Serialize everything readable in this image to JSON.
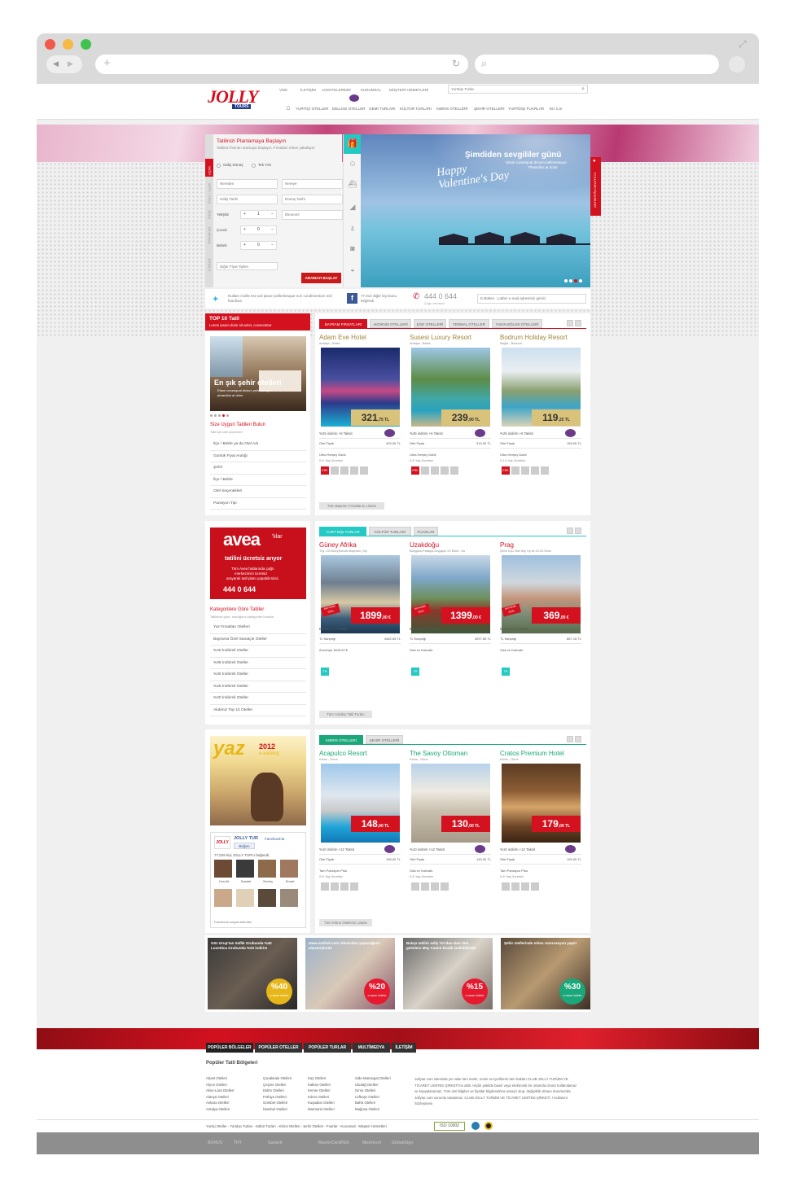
{
  "browser": {
    "nav_back": "◀",
    "nav_fwd": "▶",
    "new_tab": "+",
    "reload": "↻",
    "search": "⌕"
  },
  "header": {
    "logo_main": "JOLLY",
    "logo_sub": "TOURS",
    "top_links": [
      "VİZE",
      "İLETİŞİM",
      "ACENTELERİMİZ",
      "KURUMSAL",
      "MÜŞTERİ HİZMETLERİ"
    ],
    "search_select": "Yurtdışı Turlar",
    "search_icon": "⌕",
    "nav": [
      "YURTİÇİ OTELLER",
      "DELUXE OTELLER",
      "GEMİ TURLARI",
      "KÜLTÜR TURLARI",
      "KIBRIS OTELLERİ",
      "ŞEHİR OTELLERİ",
      "YURTDIŞI FUARLAR",
      "M.I.C.E"
    ]
  },
  "search": {
    "title": "Tatilinizi Planlamaya Başlayın",
    "subtitle": "Tatilinizi hemen aramaya başlayın. Fırsatları erken yakalayın",
    "side_tabs": [
      "UÇAK",
      "OTEL + UÇAK",
      "ARAÇ",
      "TRANSFER",
      "TURLAR"
    ],
    "radio1": "Gidiş Dönüş",
    "radio2": "Tek Yön",
    "from": "Nereden",
    "to": "Nereye",
    "depart": "Gidiş Tarihi",
    "return": "Dönüş Tarihi",
    "adult": "Yetişkin",
    "adult_val": "1",
    "child": "Çocuk",
    "child_val": "0",
    "baby": "Bebek",
    "baby_val": "0",
    "cls": "Ekonomi",
    "other": "Diğer Fiyat Tipleri",
    "button": "ARAMAYI BAŞLAT"
  },
  "banner": {
    "title": "Şimdiden sevgililer günü",
    "line1": "Etiam consequat dictum pellentesque",
    "line2": "Phasellus at dolor",
    "script": "Happy Valentine's Day",
    "side_label": "KULLANICI İŞLEMLERİ"
  },
  "social": {
    "tweet": "Nullam mollis est sed ipsum pellentesque non condimentum nisl faucibus.",
    "fb": "77.012 diğer kişi bunu beğendi.",
    "phone": "444 0 644",
    "phone_sub": "Çağrı merkezi",
    "ebulten": "E-Bülten : Lütfen e-mail adresinizi giriniz"
  },
  "top10": {
    "title": "TOP 10 Tatil",
    "sub": "Lorem ipsum dolor sit amet, consectetur",
    "photo_title": "En şık şehir otelleri",
    "photo_sub1": "Etiam consequat dictum pellentesque",
    "photo_sub2": "phasellus at dolor",
    "find_title": "Size Uygun Tatilleri Bulun",
    "find_sub": "Tatil için tatil çözümleri",
    "items": [
      "İlçe / Belde ya da Otel Adı",
      "Günlük Fiyat Aralığı",
      "Şehir",
      "İlçe / Belde",
      "Otel Seçenekleri",
      "Pansiyon Tipi"
    ]
  },
  "sec1": {
    "tabs": [
      "BAYRAM FIRSATLARI",
      "AKDENİZ OTELLERİ",
      "EGE OTELLERİ",
      "TERMAL OTELLER",
      "YAKIN BÖLGE OTELLERİ"
    ],
    "list_btn": "Tüm Bayram Fırsatlarını Listele",
    "cards": [
      {
        "name": "Adam Eve Hotel",
        "loc": "Antalya - Belek",
        "price_big": "321",
        "price_small": ",75 TL",
        "promo": "%25 indirim +6 Taksit",
        "row1": "Otel Fiyatı",
        "row1v": "429.00 TL",
        "row2": "Ultra Herşey Dahil",
        "row3": "0-6 Yaş Ücretsiz"
      },
      {
        "name": "Susesi Luxury Resort",
        "loc": "Antalya - Belek",
        "price_big": "239",
        "price_small": ",90 TL",
        "promo": "%25 indirim +6 Taksit",
        "row1": "Otel Fiyatı",
        "row1v": "319.00 TL",
        "row2": "Ultra Herşey Dahil",
        "row3": "0-6 Yaş Ücretsiz"
      },
      {
        "name": "Bodrum Holiday Resort",
        "loc": "Muğla - Bodrum",
        "price_big": "119",
        "price_small": ",25 TL",
        "promo": "%25 indirim +6 Taksit",
        "row1": "Otel Fiyatı",
        "row1v": "159.00 TL",
        "row2": "Ultra Herşey Dahil",
        "row3": "0-14 Yaş Ücretsiz"
      }
    ],
    "erk": "ERK"
  },
  "avea": {
    "brand": "avea",
    "brand2": "'lılar",
    "l1": "tatilini ücretsiz arıyor",
    "l2": "Tüm Avea hatlarında çağrı",
    "l3": "merkezimizi ücretsiz",
    "l4": "arayarak tatil planı yapabilirsiniz.",
    "phone": "444 0 644"
  },
  "cats": {
    "title": "Kategorilere Göre Tatiller",
    "sub": "Tatilinize göre, aradığınız kategoriler burada",
    "items": [
      "Yaz Fırsatları Otelleri",
      "Bayrama Özel Sanatçılı Oteller",
      "%40 İndirimli Oteller",
      "%35 İndirimli Oteller",
      "%30 İndirimli Oteller",
      "%25 İndirimli Oteller",
      "%20 İndirimli Oteller",
      "Akdeniz Top 10 Oteller"
    ]
  },
  "sec2": {
    "tabs": [
      "YURT DIŞI TURLAR",
      "KÜLTÜR TURLARI",
      "FUARLAR"
    ],
    "list_btn": "Tüm Yurtdışı Tatil Turları",
    "badge": "BAYRAMA ÖZEL",
    "tr": "TR",
    "cards": [
      {
        "name": "Güney Afrika",
        "loc": "Thy -20 Ekim(Kurban Bayramı ) By",
        "price_big": "1899",
        "price_small": ",00 €",
        "promo": "Bonus 2-12 Taksit",
        "row1": "TL Karşılığı",
        "row1v": "4462.65 TL",
        "row2": "Avea'lıya 1849.00 €"
      },
      {
        "name": "Uzakdoğu",
        "loc": "Bangkok-Pattaya-Singapur 29 Ekim - Ku",
        "price_big": "1399",
        "price_small": ",00 €",
        "promo": "Bonus 2-12 Taksit",
        "row1": "TL Karşılığı",
        "row1v": "3297.65 TL",
        "row2": "Oda ve Kahvaltı"
      },
      {
        "name": "Prag",
        "loc": "Şehir Dışı Otel Sky Hy ile 22-25 Ekim",
        "price_big": "369",
        "price_small": ",00 €",
        "promo": "Bonus 2-12 Taksit",
        "row1": "TL Karşılığı",
        "row1v": "867.15 TL",
        "row2": "Oda ve Kahvaltı"
      }
    ]
  },
  "yaz": {
    "big": "yaz",
    "year": "2012",
    "sub": "e-katalog"
  },
  "fbbox": {
    "name": "JOLLY TUR",
    "suffix": "Facebook'ta",
    "like": "Beğen",
    "count": "77,029 kişi JOLLY TUR'u beğendi.",
    "people": [
      "Can Ali",
      "Saadet",
      "Sevinç",
      "Smart"
    ],
    "footer": "Facebook sosyal eklentisi"
  },
  "sec3": {
    "tabs": [
      "KIBRIS OTELLERİ",
      "ŞEHİR OTELLERİ"
    ],
    "list_btn": "Tüm Kıbrıs Otellerini Listele",
    "cards": [
      {
        "name": "Acapulco Resort",
        "loc": "Kıbrıs - Girne",
        "price_big": "148",
        "price_small": ",00 TL",
        "promo": "%10 indirim +12 Taksit",
        "row1": "Otel Fiyatı",
        "row1v": "165.00 TL",
        "row2": "Tam Pansiyon Plus",
        "row3": "0-6 Yaş Ücretsiz"
      },
      {
        "name": "The Savoy Ottoman",
        "loc": "Kıbrıs - Girne",
        "price_big": "130",
        "price_small": ",00 TL",
        "promo": "%10 indirim +12 Taksit",
        "row1": "Otel Fiyatı",
        "row1v": "145.00 TL",
        "row2": "Oda ve Kahvaltı",
        "row3": "0-6 Yaş Ücretsiz"
      },
      {
        "name": "Cratos Premium Hotel",
        "loc": "Kıbrıs - Girne",
        "price_big": "179",
        "price_small": ",00 TL",
        "promo": "%10 indirim +12 Taksit",
        "row1": "Otel Fiyatı",
        "row1v": "199.00 TL",
        "row2": "Tam Pansiyon Plus",
        "row3": "0-6 Yaş Ücretsiz"
      }
    ]
  },
  "promos": [
    {
      "text": "Göz Grup'tan Saflık Grubunda %40 Luxottica Grubunda %20 indirim",
      "pct": "%40",
      "lbl": "a varan indirim"
    },
    {
      "text": "www.vatilick.com sitesinden yapacağınız alışverişlerde",
      "pct": "%20",
      "lbl": "a varan indirim"
    },
    {
      "text": "Balayı tatilini Jolly Tur'dan alan tüm gelinlere Mey Casini kiralık Gelinliklerde",
      "pct": "%15",
      "lbl": "a varan indirim"
    },
    {
      "text": "Şehir otellerinde erken rezervasyon yapın",
      "pct": "%30",
      "lbl": "a varan indirim"
    }
  ],
  "footer": {
    "tabs": [
      "POPÜLER BÖLGELER",
      "POPÜLER OTELLER",
      "POPÜLER TURLAR",
      "MULTİMEDYA",
      "İLETİŞİM"
    ],
    "title": "Popüler Tatil Bölgeleri",
    "col1": [
      "Abant Otelleri",
      "Afyon Otelleri",
      "Akso-Lara Otelleri",
      "Alanya Otelleri",
      "Ankara Otelleri",
      "Antalya Otelleri"
    ],
    "col2": [
      "Çanakkale Otelleri",
      "Çeşme Otelleri",
      "Didim Otelleri",
      "Fethiye Otelleri",
      "Gümbet Otelleri",
      "İstanbul Otelleri"
    ],
    "col3": [
      "Kaş Otelleri",
      "Kalkan Otelleri",
      "Kemer Otelleri",
      "Kıbrıs Otelleri",
      "Kuşadası Otelleri",
      "Marmaris Otelleri"
    ],
    "col4": [
      "Side-Manavgat Otelleri",
      "Uludağ Otelleri",
      "Girne Otelleri",
      "Lefkoşe Otelleri",
      "Bafra Otelleri",
      "Mağosa Otelleri"
    ],
    "legal": "Jollytur.com sitesinde yer alan tüm metin, resim ve içeriklerin tüm hakları CLUB JOLLY TURİZM VE TİCARET LİMİTED ŞİRKETİ'ne aittir. Hiçbir şekilde basılı veya elektronik bir ortamda izinsiz kullanılamaz ve kopyalanamaz. Tüm otel bilgileri ve fiyatlar bilgilendirme amaçlı olup, değişiklik olması durumunda Jollytur.com sorumlu tutulamaz. CLUB JOLLY TURİZM VE TİCARET LİMİTED ŞİRKETİ. / Kullanım Sözleşmesi",
    "bottom_links": "Yurtiçi Oteller - Yurtdışı Turları - Kültür Turları - Kıbrıs Otelleri - Şehir Otelleri - Fuarlar - Kurumsal - Müşteri Hizmetleri",
    "iso": "ISO 10002",
    "banks": [
      "BONUS",
      "THY",
      "Garanti",
      "MasterCard",
      "VISA",
      "Maximum",
      "GlobalSign"
    ]
  },
  "colors": {
    "red": "#d3111f",
    "teal": "#23c9c3",
    "green": "#1aa779",
    "gold": "#d9c37a"
  }
}
